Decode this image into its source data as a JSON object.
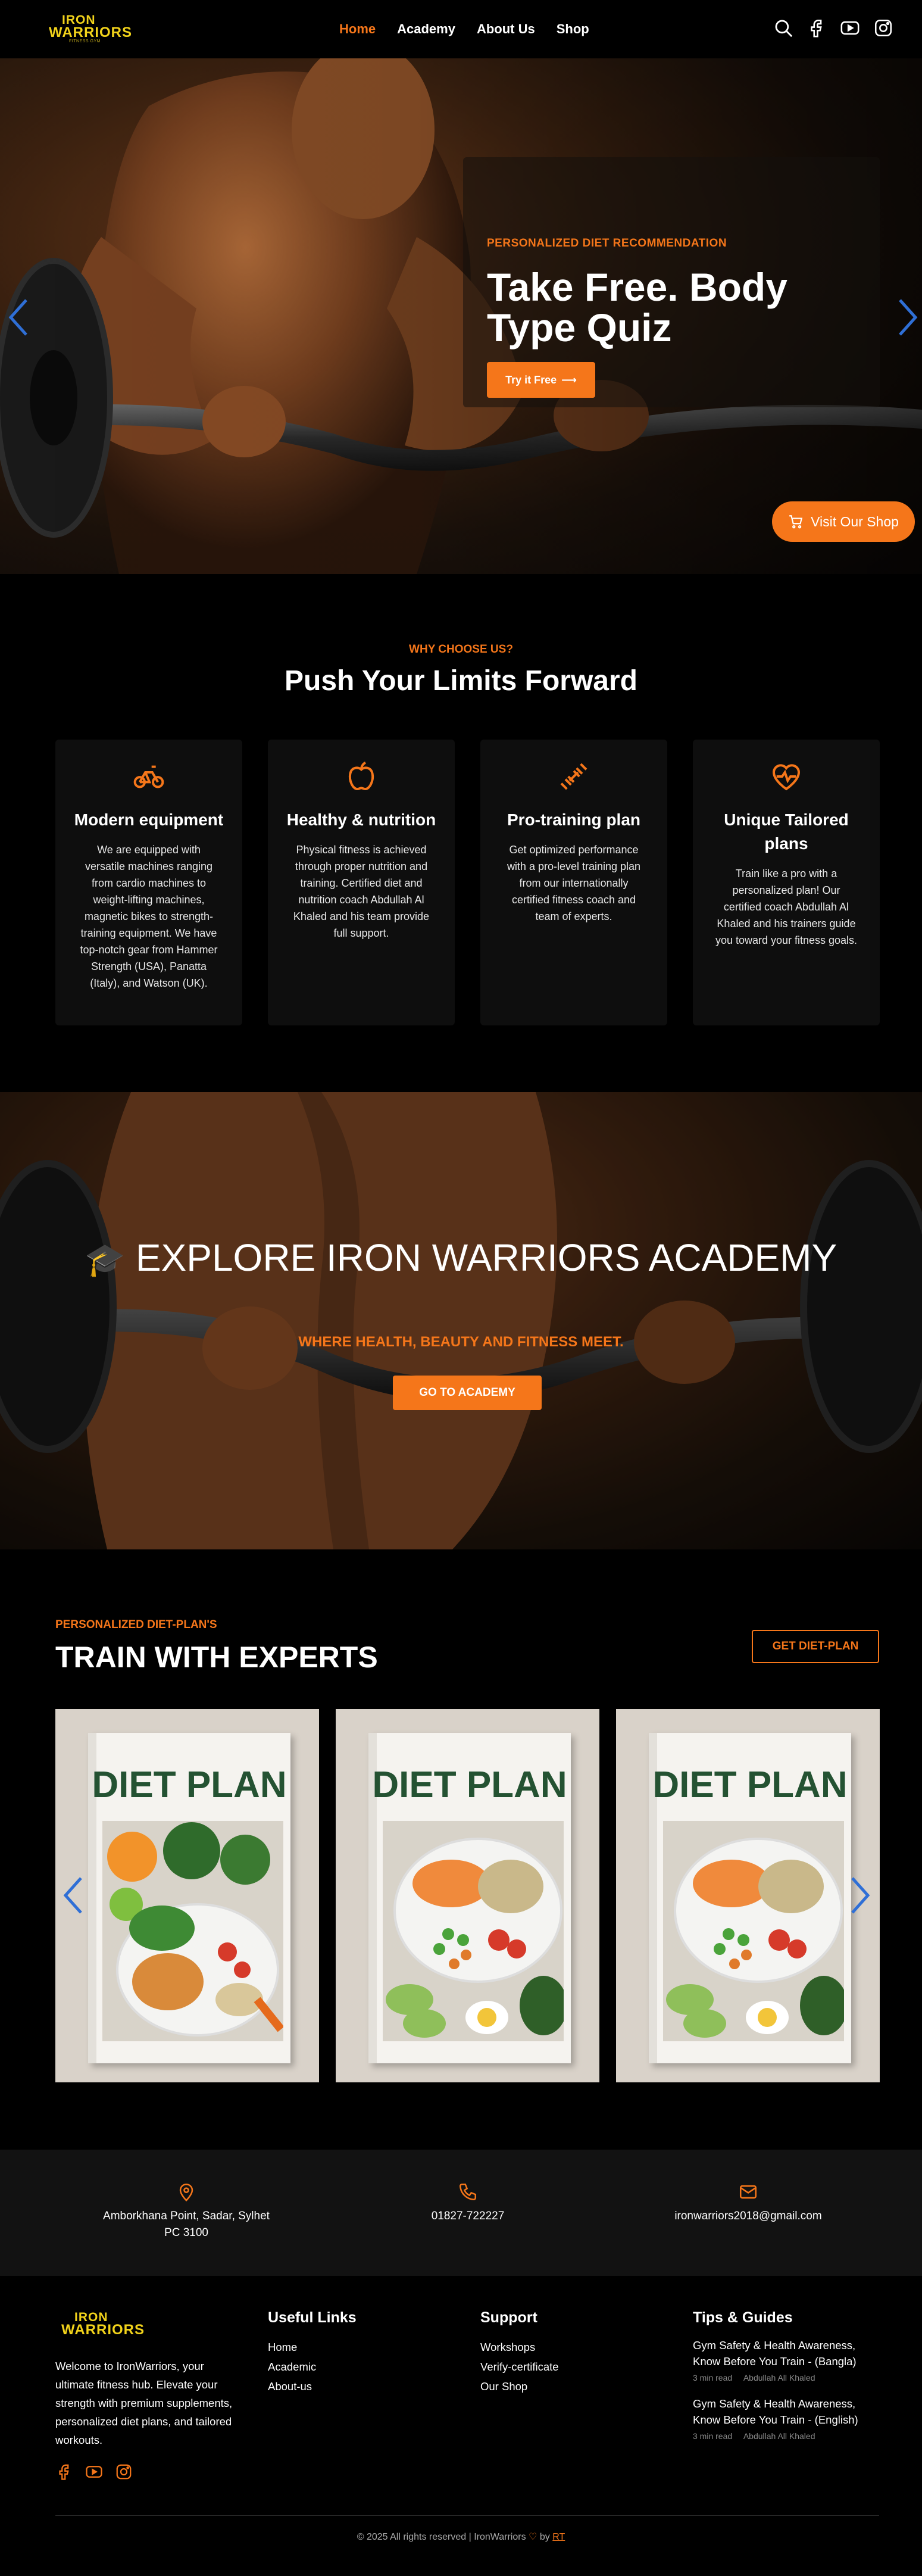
{
  "brand": {
    "logo_line1": "IRON",
    "logo_line2": "WARRIORS",
    "logo_tagline": "FITNESS GYM"
  },
  "nav": {
    "items": [
      {
        "label": "Home",
        "active": true
      },
      {
        "label": "Academy",
        "active": false
      },
      {
        "label": "About Us",
        "active": false
      },
      {
        "label": "Shop",
        "active": false
      }
    ],
    "icons": [
      "search-icon",
      "facebook-icon",
      "youtube-icon",
      "instagram-icon"
    ]
  },
  "hero": {
    "kicker": "PERSONALIZED DIET RECOMMENDATION",
    "title": "Take Free. Body Type Quiz",
    "button_label": "Try it Free",
    "shop_button_label": "Visit Our Shop"
  },
  "why": {
    "kicker": "WHY CHOOSE US?",
    "title": "Push Your Limits Forward",
    "features": [
      {
        "icon": "bicycle-icon",
        "title": "Modern equipment",
        "text": "We are equipped with versatile machines ranging from cardio machines to weight-lifting machines, magnetic bikes to strength-training equipment. We have top-notch gear from Hammer Strength (USA), Panatta (Italy), and Watson (UK)."
      },
      {
        "icon": "apple-icon",
        "title": "Healthy & nutrition",
        "text": "Physical fitness is achieved through proper nutrition and training. Certified diet and nutrition coach Abdullah Al Khaled and his team provide full support."
      },
      {
        "icon": "dumbbell-icon",
        "title": "Pro-training plan",
        "text": "Get optimized performance with a pro-level training plan from our internationally certified fitness coach and team of experts."
      },
      {
        "icon": "heartbeat-icon",
        "title": "Unique Tailored plans",
        "text": "Train like a pro with a personalized plan! Our certified coach Abdullah Al Khaled and his trainers guide you toward your fitness goals."
      }
    ]
  },
  "academy": {
    "icon": "graduation-cap-icon",
    "title": "EXPLORE IRON WARRIORS ACADEMY",
    "subtitle": "WHERE HEALTH, BEAUTY AND FITNESS MEET.",
    "button_label": "GO TO ACADEMY"
  },
  "diet": {
    "kicker": "PERSONALIZED DIET-PLAN'S",
    "title": "TRAIN WITH EXPERTS",
    "button_label": "GET DIET-PLAN",
    "cards": [
      {
        "title": "DIET PLAN"
      },
      {
        "title": "DIET PLAN"
      },
      {
        "title": "DIET PLAN"
      }
    ]
  },
  "contact": {
    "address": "Amborkhana Point, Sadar, Sylhet PC 3100",
    "phone": "01827-722227",
    "email": "ironwarriors2018@gmail.com"
  },
  "footer": {
    "about": "Welcome to IronWarriors, your ultimate fitness hub. Elevate your strength with premium supplements, personalized diet plans, and tailored workouts.",
    "useful_links": {
      "title": "Useful Links",
      "items": [
        "Home",
        "Academic",
        "About-us"
      ]
    },
    "support": {
      "title": "Support",
      "items": [
        "Workshops",
        "Verify-certificate",
        "Our Shop"
      ]
    },
    "tips": {
      "title": "Tips & Guides",
      "items": [
        {
          "title": "Gym Safety & Health Awareness, Know Before You Train - (Bangla)",
          "read": "3 min read",
          "author": "Abdullah All Khaled"
        },
        {
          "title": "Gym Safety & Health Awareness, Know Before You Train - (English)",
          "read": "3 min read",
          "author": "Abdullah All Khaled"
        }
      ]
    },
    "copyright": "© 2025 All rights reserved | IronWarriors",
    "by_prefix": "by",
    "by_name": "RT"
  },
  "colors": {
    "accent": "#f5761a",
    "logo": "#f2d31b",
    "bg": "#000000",
    "card": "#0e0e0e",
    "arrow": "#2f6fd6"
  }
}
